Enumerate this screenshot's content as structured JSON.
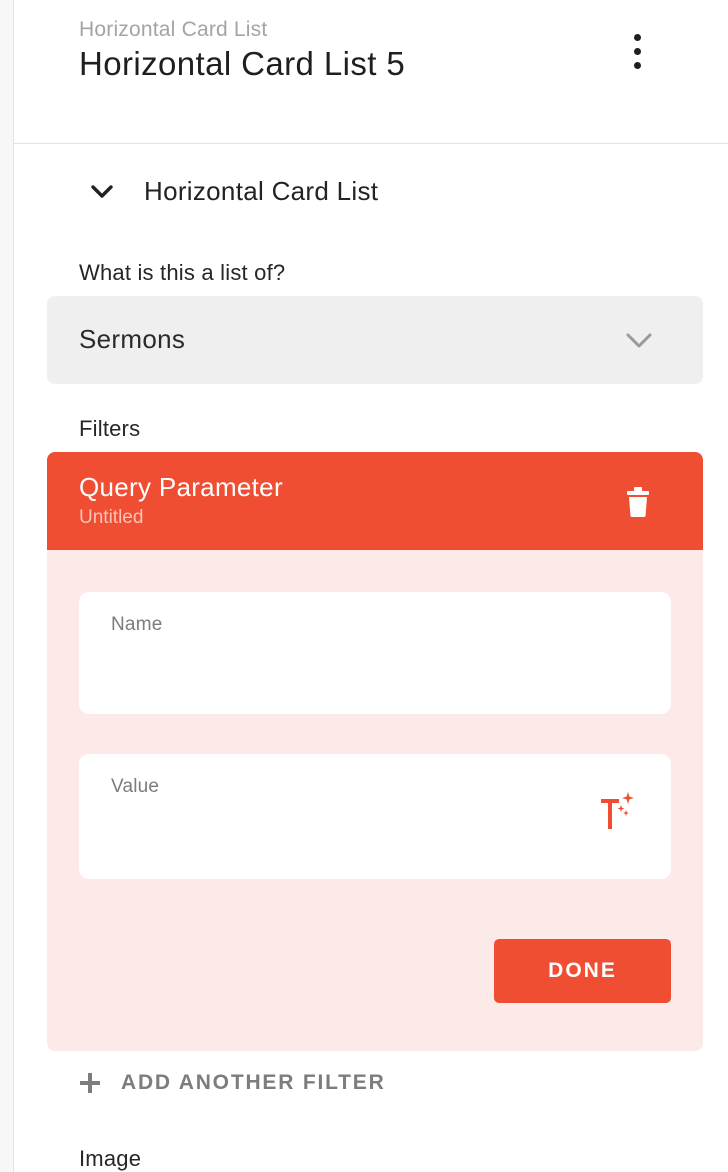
{
  "header": {
    "overline": "Horizontal Card List",
    "title": "Horizontal Card List 5",
    "menu_icon": "kebab-menu-icon"
  },
  "section": {
    "title": "Horizontal Card List",
    "toggle_icon": "chevron-down-icon",
    "expanded": true
  },
  "list_of": {
    "label": "What is this a list of?",
    "selected": "Sermons",
    "icon": "chevron-down-icon"
  },
  "filters": {
    "label": "Filters",
    "items": [
      {
        "title": "Query Parameter",
        "subtitle": "Untitled",
        "delete_icon": "trash-icon",
        "fields": {
          "name_label": "Name",
          "name_value": "",
          "value_label": "Value",
          "value_value": "",
          "value_icon": "magic-text-icon"
        },
        "done_label": "DONE"
      }
    ],
    "add_label": "ADD ANOTHER FILTER",
    "add_icon": "plus-icon"
  },
  "image": {
    "label": "Image"
  },
  "colors": {
    "accent": "#EF4E33",
    "card_background": "#FBEAE7",
    "select_background": "#EFEFEF"
  }
}
